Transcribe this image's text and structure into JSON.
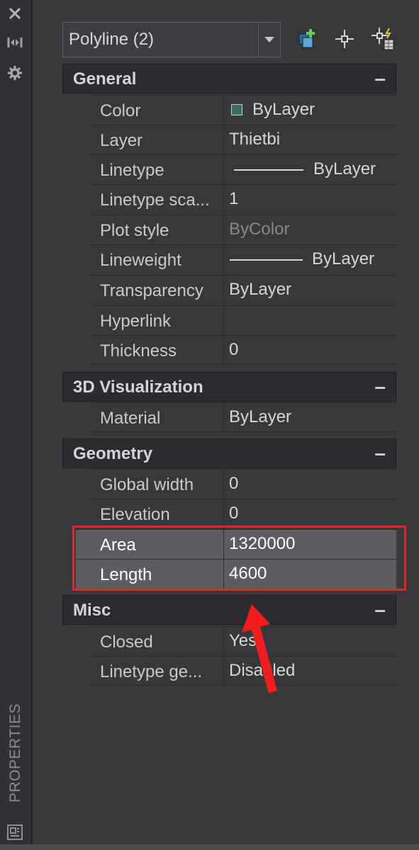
{
  "combo": {
    "selected": "Polyline (2)"
  },
  "toolbar": {
    "quick_select": "quick-select-icon",
    "select_objects": "select-objects-icon",
    "toggle_pickadd": "pickadd-icon"
  },
  "left_strip": {
    "vertical_label": "PROPERTIES"
  },
  "sections": {
    "general": {
      "title": "General",
      "toggle": "–"
    },
    "visualization": {
      "title": "3D Visualization",
      "toggle": "–"
    },
    "geometry": {
      "title": "Geometry",
      "toggle": "–"
    },
    "misc": {
      "title": "Misc",
      "toggle": "–"
    }
  },
  "general": {
    "color": {
      "name": "Color",
      "value": "ByLayer",
      "swatch": "#3c6b62"
    },
    "layer": {
      "name": "Layer",
      "value": "Thietbi"
    },
    "linetype": {
      "name": "Linetype",
      "value": "ByLayer"
    },
    "linetype_scale": {
      "name": "Linetype sca...",
      "value": "1"
    },
    "plot_style": {
      "name": "Plot style",
      "value": "ByColor"
    },
    "lineweight": {
      "name": "Lineweight",
      "value": "ByLayer"
    },
    "transparency": {
      "name": "Transparency",
      "value": "ByLayer"
    },
    "hyperlink": {
      "name": "Hyperlink",
      "value": ""
    },
    "thickness": {
      "name": "Thickness",
      "value": "0"
    }
  },
  "visualization": {
    "material": {
      "name": "Material",
      "value": "ByLayer"
    }
  },
  "geometry": {
    "global_width": {
      "name": "Global width",
      "value": "0"
    },
    "elevation": {
      "name": "Elevation",
      "value": "0"
    },
    "area": {
      "name": "Area",
      "value": "1320000"
    },
    "length": {
      "name": "Length",
      "value": "4600"
    }
  },
  "misc": {
    "closed": {
      "name": "Closed",
      "value": "Yes"
    },
    "linetype_gen": {
      "name": "Linetype ge...",
      "value": "Disabled"
    }
  },
  "colors": {
    "highlight_box": "#e0262a",
    "arrow": "#f21c1c"
  }
}
